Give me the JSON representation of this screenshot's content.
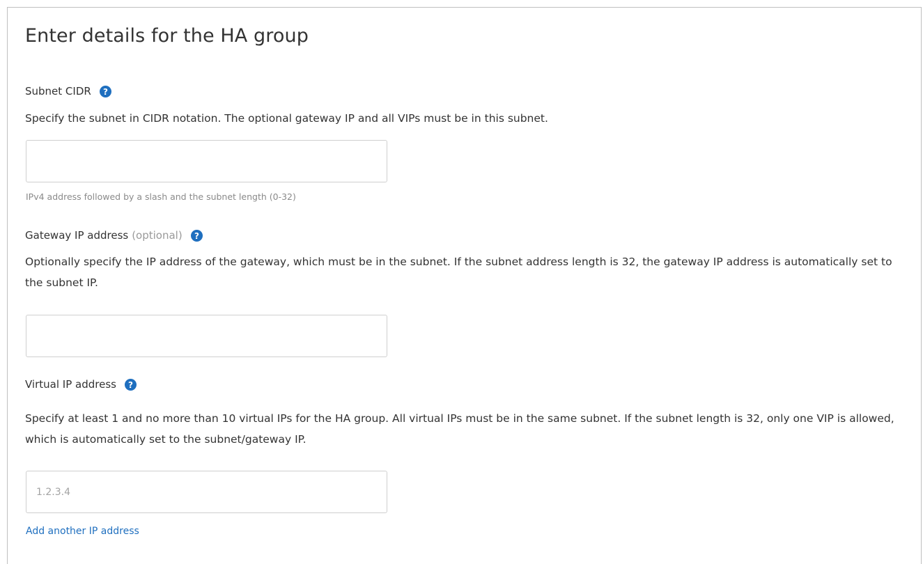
{
  "page": {
    "title": "Enter details for the HA group"
  },
  "subnet_cidr": {
    "label": "Subnet CIDR",
    "help_icon": "question-circle-icon",
    "description": "Specify the subnet in CIDR notation. The optional gateway IP and all VIPs must be in this subnet.",
    "value": "",
    "placeholder": "",
    "hint": "IPv4 address followed by a slash and the subnet length (0-32)"
  },
  "gateway_ip": {
    "label": "Gateway IP address",
    "optional_text": "(optional)",
    "help_icon": "question-circle-icon",
    "description": "Optionally specify the IP address of the gateway, which must be in the subnet. If the subnet address length is 32, the gateway IP address is automatically set to the subnet IP.",
    "value": "",
    "placeholder": ""
  },
  "virtual_ip": {
    "label": "Virtual IP address",
    "help_icon": "question-circle-icon",
    "description": "Specify at least 1 and no more than 10 virtual IPs for the HA group. All virtual IPs must be in the same subnet. If the subnet length is 32, only one VIP is allowed, which is automatically set to the subnet/gateway IP.",
    "value": "",
    "placeholder": "1.2.3.4",
    "add_link": "Add another IP address"
  },
  "colors": {
    "text": "#333333",
    "muted": "#8a8a8a",
    "link": "#1f6fbf",
    "help_icon": "#1f6fbf",
    "border": "#cfcfcf"
  }
}
